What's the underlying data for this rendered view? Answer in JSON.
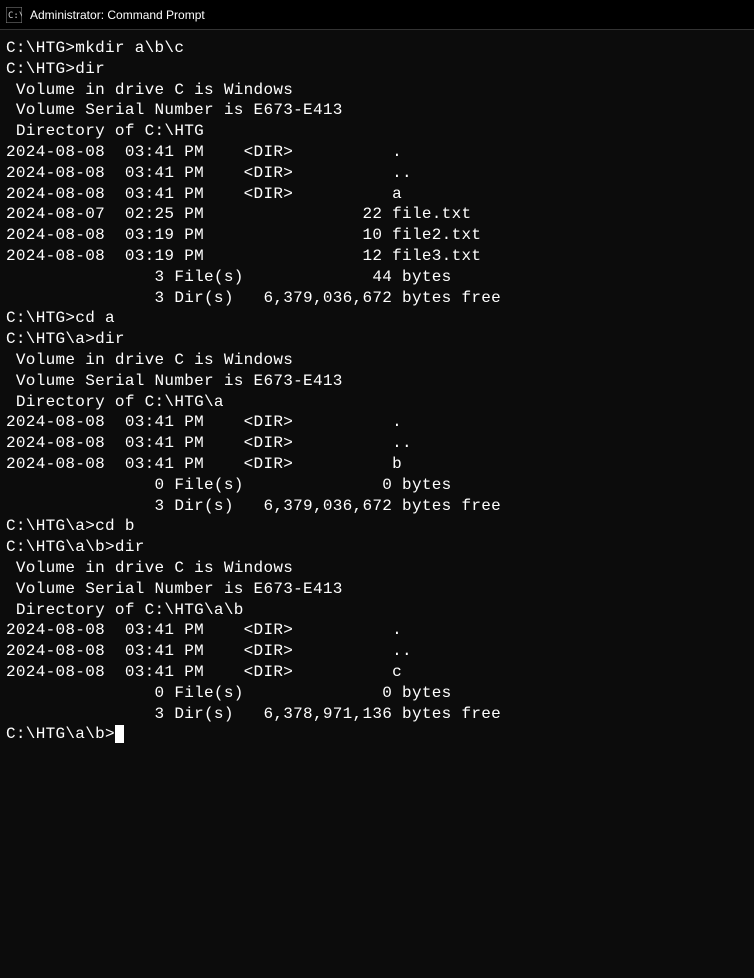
{
  "window": {
    "title": "Administrator: Command Prompt"
  },
  "lines": {
    "l0": "",
    "l1": "C:\\HTG>mkdir a\\b\\c",
    "l2": "",
    "l3": "C:\\HTG>dir",
    "l4": " Volume in drive C is Windows",
    "l5": " Volume Serial Number is E673-E413",
    "l6": "",
    "l7": " Directory of C:\\HTG",
    "l8": "",
    "l9": "2024-08-08  03:41 PM    <DIR>          .",
    "l10": "2024-08-08  03:41 PM    <DIR>          ..",
    "l11": "2024-08-08  03:41 PM    <DIR>          a",
    "l12": "2024-08-07  02:25 PM                22 file.txt",
    "l13": "2024-08-08  03:19 PM                10 file2.txt",
    "l14": "2024-08-08  03:19 PM                12 file3.txt",
    "l15": "               3 File(s)             44 bytes",
    "l16": "               3 Dir(s)   6,379,036,672 bytes free",
    "l17": "",
    "l18": "C:\\HTG>cd a",
    "l19": "",
    "l20": "C:\\HTG\\a>dir",
    "l21": " Volume in drive C is Windows",
    "l22": " Volume Serial Number is E673-E413",
    "l23": "",
    "l24": " Directory of C:\\HTG\\a",
    "l25": "",
    "l26": "2024-08-08  03:41 PM    <DIR>          .",
    "l27": "2024-08-08  03:41 PM    <DIR>          ..",
    "l28": "2024-08-08  03:41 PM    <DIR>          b",
    "l29": "               0 File(s)              0 bytes",
    "l30": "               3 Dir(s)   6,379,036,672 bytes free",
    "l31": "",
    "l32": "C:\\HTG\\a>cd b",
    "l33": "",
    "l34": "C:\\HTG\\a\\b>dir",
    "l35": " Volume in drive C is Windows",
    "l36": " Volume Serial Number is E673-E413",
    "l37": "",
    "l38": " Directory of C:\\HTG\\a\\b",
    "l39": "",
    "l40": "2024-08-08  03:41 PM    <DIR>          .",
    "l41": "2024-08-08  03:41 PM    <DIR>          ..",
    "l42": "2024-08-08  03:41 PM    <DIR>          c",
    "l43": "               0 File(s)              0 bytes",
    "l44": "               3 Dir(s)   6,378,971,136 bytes free",
    "l45": "",
    "l46": "C:\\HTG\\a\\b>"
  }
}
